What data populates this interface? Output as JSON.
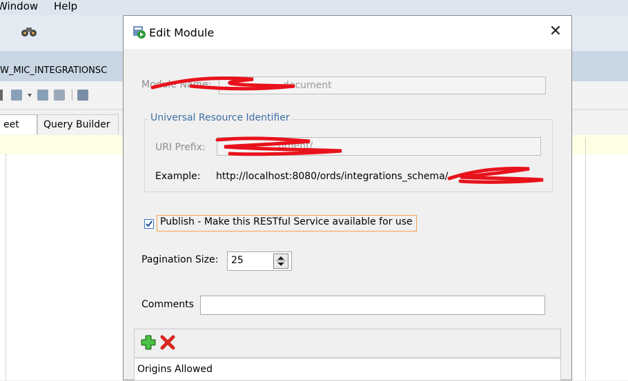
{
  "menu": {
    "window_label": "Window",
    "help_label": "Help"
  },
  "background": {
    "connection_title": "W_MIC_INTEGRATIONSC",
    "tabs": [
      "eet",
      "Query Builder"
    ]
  },
  "dialog": {
    "title": "Edit Module",
    "close_glyph": "✕",
    "module_name_label": "Module Name:",
    "module_name_value": "document",
    "uri_group_title": "Universal Resource Identifier",
    "uri_prefix_label": "URI Prefix:",
    "uri_prefix_value": "ument/",
    "example_label": "Example:",
    "example_value": "http://localhost:8080/ords/integrations_schema/",
    "example_tail": "...",
    "publish_checked": true,
    "publish_label": "Publish - Make this RESTful Service available for use",
    "pagination_label": "Pagination Size:",
    "pagination_value": "25",
    "comments_label": "Comments",
    "comments_value": "",
    "origins_header": "Origins Allowed"
  },
  "colors": {
    "accent": "#3c6ea3",
    "focus": "#f0a44a",
    "redaction": "#e8121b"
  }
}
